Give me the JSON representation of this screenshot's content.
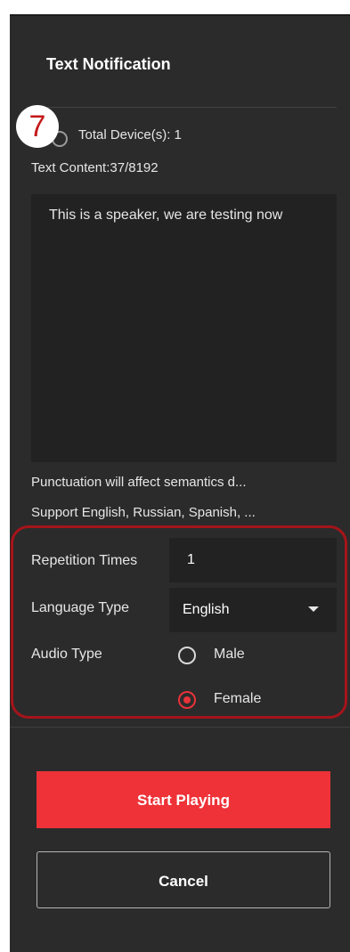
{
  "panel": {
    "title": "Text Notification",
    "step_badge": "7",
    "total_devices": "Total Device(s): 1",
    "text_content_label": "Text Content:37/8192",
    "text_content": "This is a speaker, we are testing now",
    "hint_punctuation": "Punctuation will affect semantics d...",
    "hint_languages": "Support English, Russian, Spanish, ..."
  },
  "settings": {
    "repetition_label": "Repetition Times",
    "repetition_value": "1",
    "language_label": "Language Type",
    "language_value": "English",
    "audio_label": "Audio Type",
    "audio_options": [
      "Male",
      "Female"
    ],
    "audio_selected": "Female"
  },
  "actions": {
    "start_label": "Start Playing",
    "cancel_label": "Cancel"
  },
  "colors": {
    "panel_bg": "#2b2b2b",
    "accent_red": "#ee3238",
    "highlight_border": "#a5141a"
  },
  "icons": {
    "dropdown": "chevron-down-icon",
    "radio_unchecked": "radio-off-icon",
    "radio_checked": "radio-on-icon"
  }
}
